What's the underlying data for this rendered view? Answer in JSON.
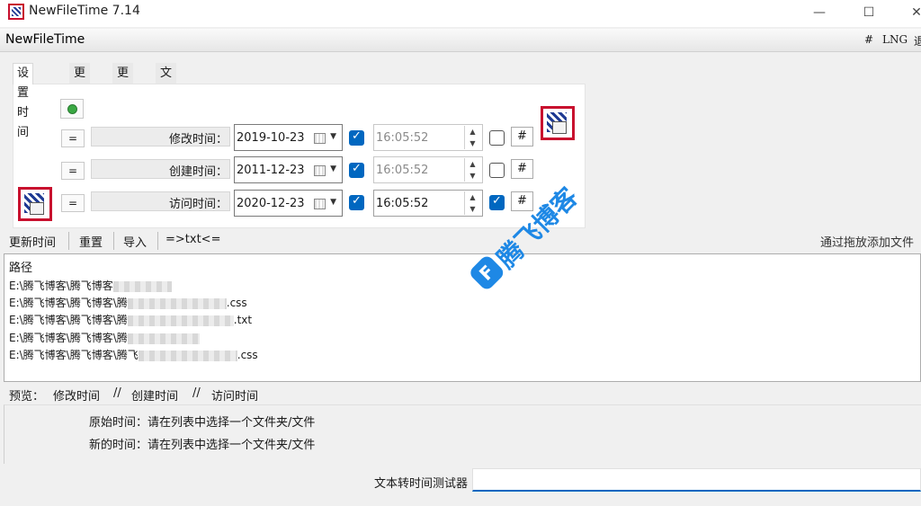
{
  "window": {
    "title": "NewFileTime 7.14",
    "min": "—",
    "max": "☐",
    "close": "✕"
  },
  "header": {
    "app_name": "NewFileTime",
    "hash": "#",
    "lng": "LNG",
    "extra": "退"
  },
  "tabs": [
    "设置时间",
    "更早些",
    "更晚些",
    "文件名转时间"
  ],
  "rows": [
    {
      "eq": "=",
      "label": "修改时间：",
      "date": "2019-10-23",
      "date_checked": true,
      "time": "16:05:52",
      "time_enabled": false,
      "time_checked": false,
      "hash": "#"
    },
    {
      "eq": "=",
      "label": "创建时间：",
      "date": "2011-12-23",
      "date_checked": true,
      "time": "16:05:52",
      "time_enabled": false,
      "time_checked": false,
      "hash": "#"
    },
    {
      "eq": "=",
      "label": "访问时间：",
      "date": "2020-12-23",
      "date_checked": true,
      "time": "16:05:52",
      "time_enabled": true,
      "time_checked": true,
      "hash": "#"
    }
  ],
  "toolbar": {
    "update": "更新时间",
    "reset": "重置",
    "import": "导入",
    "txt": "=>txt<=",
    "drag_tip": "通过拖放添加文件"
  },
  "list": {
    "header": "路径",
    "rows": [
      {
        "prefix": "E:\\腾飞博客\\腾飞博客",
        "suffix": ""
      },
      {
        "prefix": "E:\\腾飞博客\\腾飞博客\\腾",
        "suffix": ".css"
      },
      {
        "prefix": "E:\\腾飞博客\\腾飞博客\\腾",
        "suffix": ".txt"
      },
      {
        "prefix": "E:\\腾飞博客\\腾飞博客\\腾",
        "suffix": ""
      },
      {
        "prefix": "E:\\腾飞博客\\腾飞博客\\腾飞",
        "suffix": ".css"
      }
    ]
  },
  "watermark": {
    "logo": "F",
    "text": "腾飞博客"
  },
  "preview": {
    "label": "预览：",
    "modify": "修改时间",
    "sep1": "//",
    "create": "创建时间",
    "sep2": "//",
    "access": "访问时间",
    "original": "原始时间：请在列表中选择一个文件夹/文件",
    "new": "新的时间：请在列表中选择一个文件夹/文件"
  },
  "tester": {
    "label": "文本转时间测试器",
    "value": ""
  },
  "colors": {
    "accent": "#0067c0",
    "watermark": "#1e88e5",
    "icon_red": "#c8102e"
  }
}
